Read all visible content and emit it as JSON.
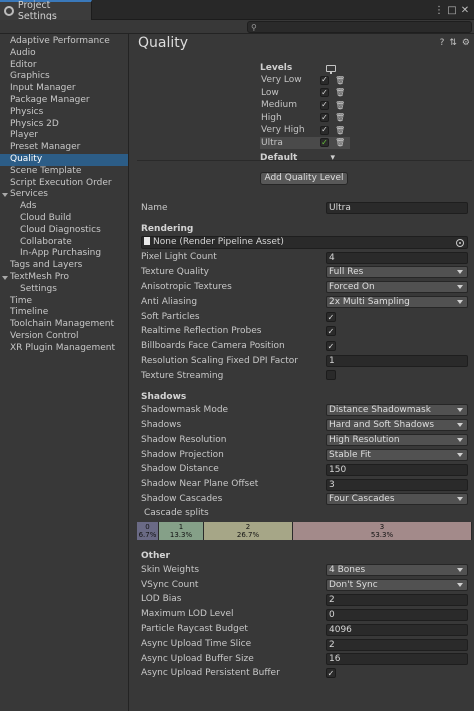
{
  "window": {
    "tab_title": "Project Settings",
    "menu_glyph": "⋮",
    "restore_glyph": "□",
    "close_glyph": "✕"
  },
  "search": {
    "placeholder": ""
  },
  "sidebar": {
    "items": [
      {
        "label": "Adaptive Performance"
      },
      {
        "label": "Audio"
      },
      {
        "label": "Editor"
      },
      {
        "label": "Graphics"
      },
      {
        "label": "Input Manager"
      },
      {
        "label": "Package Manager"
      },
      {
        "label": "Physics"
      },
      {
        "label": "Physics 2D"
      },
      {
        "label": "Player"
      },
      {
        "label": "Preset Manager"
      },
      {
        "label": "Quality"
      },
      {
        "label": "Scene Template"
      },
      {
        "label": "Script Execution Order"
      },
      {
        "label": "Services"
      },
      {
        "label": "Ads"
      },
      {
        "label": "Cloud Build"
      },
      {
        "label": "Cloud Diagnostics"
      },
      {
        "label": "Collaborate"
      },
      {
        "label": "In-App Purchasing"
      },
      {
        "label": "Tags and Layers"
      },
      {
        "label": "TextMesh Pro"
      },
      {
        "label": "Settings"
      },
      {
        "label": "Time"
      },
      {
        "label": "Timeline"
      },
      {
        "label": "Toolchain Management"
      },
      {
        "label": "Version Control"
      },
      {
        "label": "XR Plugin Management"
      }
    ],
    "selected": "Quality"
  },
  "header": {
    "title": "Quality",
    "help_glyph": "?",
    "preset_glyph": "⇅",
    "settings_glyph": "⚙"
  },
  "levels": {
    "heading": "Levels",
    "items": [
      {
        "name": "Very Low",
        "check": "✓"
      },
      {
        "name": "Low",
        "check": "✓"
      },
      {
        "name": "Medium",
        "check": "✓"
      },
      {
        "name": "High",
        "check": "✓"
      },
      {
        "name": "Very High",
        "check": "✓"
      },
      {
        "name": "Ultra",
        "check": "✓"
      }
    ],
    "default_label": "Default",
    "default_glyph": "▾",
    "add_button": "Add Quality Level"
  },
  "props": {
    "name": {
      "label": "Name",
      "value": "Ultra"
    },
    "rendering_heading": "Rendering",
    "render_pipeline_asset": "None (Render Pipeline Asset)",
    "pixel_light_count": {
      "label": "Pixel Light Count",
      "value": "4"
    },
    "texture_quality": {
      "label": "Texture Quality",
      "value": "Full Res"
    },
    "anisotropic_textures": {
      "label": "Anisotropic Textures",
      "value": "Forced On"
    },
    "anti_aliasing": {
      "label": "Anti Aliasing",
      "value": "2x Multi Sampling"
    },
    "soft_particles": {
      "label": "Soft Particles",
      "check": "✓"
    },
    "realtime_reflection_probes": {
      "label": "Realtime Reflection Probes",
      "check": "✓"
    },
    "billboards_face_camera": {
      "label": "Billboards Face Camera Position",
      "check": "✓"
    },
    "resolution_scaling": {
      "label": "Resolution Scaling Fixed DPI Factor",
      "value": "1"
    },
    "texture_streaming": {
      "label": "Texture Streaming",
      "check": ""
    },
    "shadows_heading": "Shadows",
    "shadowmask_mode": {
      "label": "Shadowmask Mode",
      "value": "Distance Shadowmask"
    },
    "shadows": {
      "label": "Shadows",
      "value": "Hard and Soft Shadows"
    },
    "shadow_resolution": {
      "label": "Shadow Resolution",
      "value": "High Resolution"
    },
    "shadow_projection": {
      "label": "Shadow Projection",
      "value": "Stable Fit"
    },
    "shadow_distance": {
      "label": "Shadow Distance",
      "value": "150"
    },
    "shadow_near_plane_offset": {
      "label": "Shadow Near Plane Offset",
      "value": "3"
    },
    "shadow_cascades": {
      "label": "Shadow Cascades",
      "value": "Four Cascades"
    },
    "cascade_splits_label": "Cascade splits",
    "cascades": [
      {
        "index": "0",
        "percent": "6.7%",
        "fraction": 0.067,
        "color": "#6a6a85"
      },
      {
        "index": "1",
        "percent": "13.3%",
        "fraction": 0.133,
        "color": "#85a088"
      },
      {
        "index": "2",
        "percent": "26.7%",
        "fraction": 0.267,
        "color": "#a6a687"
      },
      {
        "index": "3",
        "percent": "53.3%",
        "fraction": 0.533,
        "color": "#a38a8a"
      }
    ],
    "other_heading": "Other",
    "skin_weights": {
      "label": "Skin Weights",
      "value": "4 Bones"
    },
    "vsync_count": {
      "label": "VSync Count",
      "value": "Don't Sync"
    },
    "lod_bias": {
      "label": "LOD Bias",
      "value": "2"
    },
    "maximum_lod_level": {
      "label": "Maximum LOD Level",
      "value": "0"
    },
    "particle_raycast_budget": {
      "label": "Particle Raycast Budget",
      "value": "4096"
    },
    "async_upload_time_slice": {
      "label": "Async Upload Time Slice",
      "value": "2"
    },
    "async_upload_buffer_size": {
      "label": "Async Upload Buffer Size",
      "value": "16"
    },
    "async_upload_persistent_buffer": {
      "label": "Async Upload Persistent Buffer",
      "check": "✓"
    }
  },
  "colors": {
    "accent": "#2c5d87",
    "tab_accent": "#3a79bb",
    "check_green": "#67c23a"
  }
}
